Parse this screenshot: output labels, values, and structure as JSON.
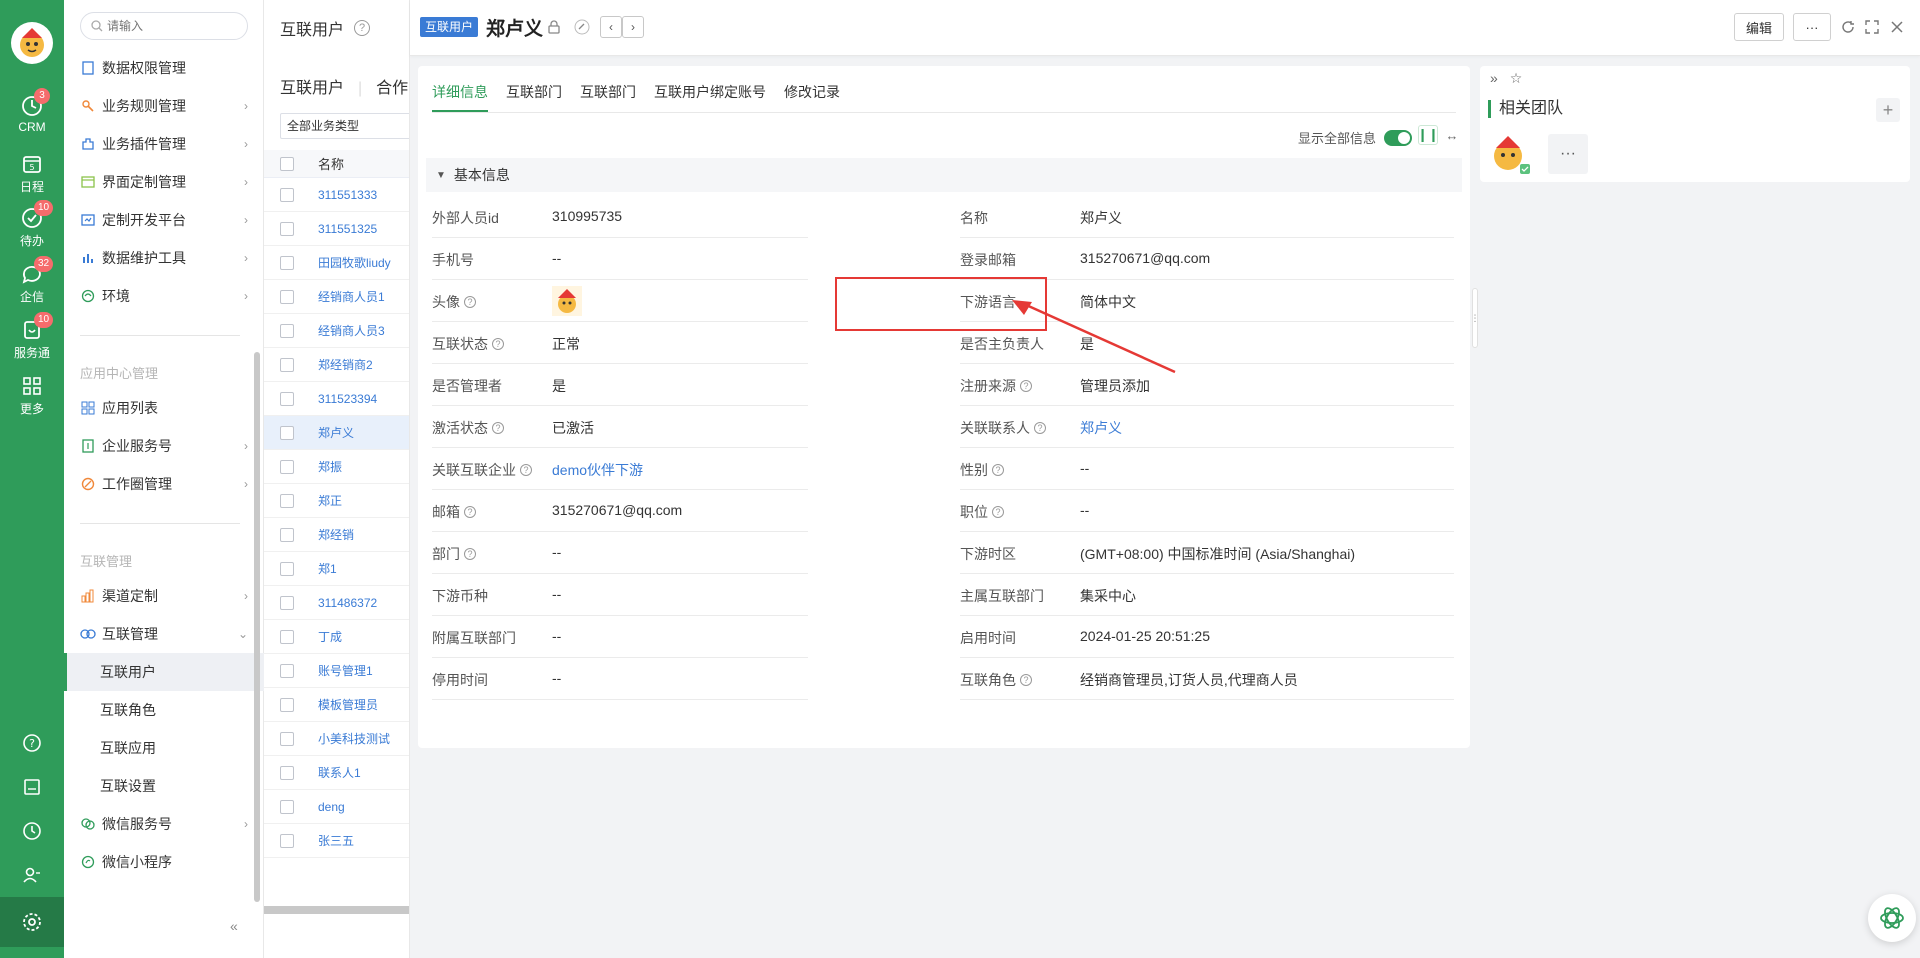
{
  "rail": {
    "items": [
      {
        "label": "CRM",
        "badge": "3"
      },
      {
        "label": "日程",
        "badge": ""
      },
      {
        "label": "待办",
        "badge": "10"
      },
      {
        "label": "企信",
        "badge": "32"
      },
      {
        "label": "服务通",
        "badge": "10"
      },
      {
        "label": "更多",
        "badge": ""
      }
    ],
    "calendar_day": "5"
  },
  "sidebar": {
    "search_placeholder": "请输入",
    "items_top": [
      {
        "label": "数据权限管理",
        "icon": "data-permission-icon"
      },
      {
        "label": "业务规则管理",
        "icon": "business-rule-icon"
      },
      {
        "label": "业务插件管理",
        "icon": "plugin-icon"
      },
      {
        "label": "界面定制管理",
        "icon": "ui-custom-icon"
      },
      {
        "label": "定制开发平台",
        "icon": "dev-platform-icon"
      },
      {
        "label": "数据维护工具",
        "icon": "data-tool-icon"
      },
      {
        "label": "环境",
        "icon": "environment-icon"
      }
    ],
    "group_app": "应用中心管理",
    "items_app": [
      {
        "label": "应用列表",
        "icon": "app-list-icon"
      },
      {
        "label": "企业服务号",
        "icon": "service-account-icon"
      },
      {
        "label": "工作圈管理",
        "icon": "work-circle-icon"
      }
    ],
    "group_interconnect": "互联管理",
    "items_interconnect": [
      {
        "label": "渠道定制",
        "icon": "channel-icon"
      },
      {
        "label": "互联管理",
        "icon": "interconnect-icon"
      },
      {
        "label": "互联用户"
      },
      {
        "label": "互联角色"
      },
      {
        "label": "互联应用"
      },
      {
        "label": "互联设置"
      },
      {
        "label": "微信服务号",
        "icon": "wechat-icon"
      },
      {
        "label": "微信小程序",
        "icon": "mini-program-icon"
      }
    ],
    "collapse": "«"
  },
  "list": {
    "title": "互联用户",
    "tab_1": "互联用户",
    "tab_2": "合作",
    "filter": "全部业务类型",
    "column_name": "名称",
    "rows": [
      "311551333",
      "311551325",
      "田园牧歌liudy",
      "经销商人员1",
      "经销商人员3",
      "郑经销商2",
      "311523394",
      "郑卢义",
      "郑振",
      "郑正",
      "郑经销",
      "郑1",
      "311486372",
      "丁成",
      "账号管理1",
      "模板管理员",
      "小美科技测试",
      "联系人1",
      "deng",
      "张三五"
    ]
  },
  "detail": {
    "tag": "互联用户",
    "title": "郑卢义",
    "edit_label": "编辑",
    "more_label": "···",
    "tabs": [
      "详细信息",
      "互联部门",
      "互联部门",
      "互联用户绑定账号",
      "修改记录"
    ],
    "show_all_label": "显示全部信息",
    "section_title": "基本信息",
    "left_fields": [
      {
        "label": "外部人员id",
        "value": "310995735",
        "help": false
      },
      {
        "label": "手机号",
        "value": "--",
        "help": false
      },
      {
        "label": "头像",
        "value": "",
        "help": true
      },
      {
        "label": "互联状态",
        "value": "正常",
        "help": true
      },
      {
        "label": "是否管理者",
        "value": "是",
        "help": false
      },
      {
        "label": "激活状态",
        "value": "已激活",
        "help": true
      },
      {
        "label": "关联互联企业",
        "value": "demo伙伴下游",
        "help": true,
        "link": true
      },
      {
        "label": "邮箱",
        "value": "315270671@qq.com",
        "help": true
      },
      {
        "label": "部门",
        "value": "--",
        "help": true
      },
      {
        "label": "下游币种",
        "value": "--",
        "help": false
      },
      {
        "label": "附属互联部门",
        "value": "--",
        "help": false
      },
      {
        "label": "停用时间",
        "value": "--",
        "help": false
      }
    ],
    "right_fields": [
      {
        "label": "名称",
        "value": "郑卢义",
        "help": false
      },
      {
        "label": "登录邮箱",
        "value": "315270671@qq.com",
        "help": false
      },
      {
        "label": "下游语言",
        "value": "简体中文",
        "help": false
      },
      {
        "label": "是否主负责人",
        "value": "是",
        "help": false
      },
      {
        "label": "注册来源",
        "value": "管理员添加",
        "help": true
      },
      {
        "label": "关联联系人",
        "value": "郑卢义",
        "help": true,
        "link": true
      },
      {
        "label": "性别",
        "value": "--",
        "help": true
      },
      {
        "label": "职位",
        "value": "--",
        "help": true
      },
      {
        "label": "下游时区",
        "value": "(GMT+08:00) 中国标准时间 (Asia/Shanghai)",
        "help": false
      },
      {
        "label": "主属互联部门",
        "value": "集采中心",
        "help": false
      },
      {
        "label": "启用时间",
        "value": "2024-01-25 20:51:25",
        "help": false
      },
      {
        "label": "互联角色",
        "value": "经销商管理员,订货人员,代理商人员",
        "help": true
      }
    ]
  },
  "related": {
    "title": "相关团队",
    "add": "+",
    "more": "···"
  },
  "colors": {
    "brand_green": "#2f9c5a",
    "link_blue": "#3a7bd5",
    "annotation_red": "#e53935"
  }
}
